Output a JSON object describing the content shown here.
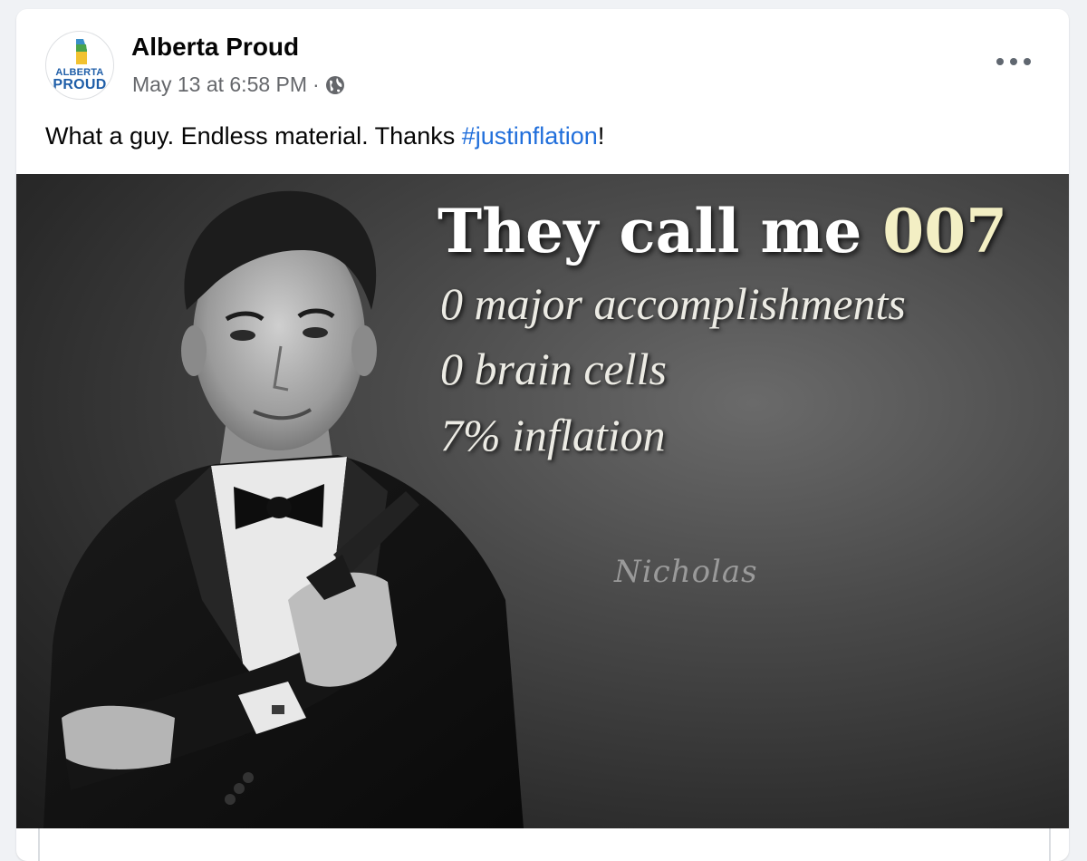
{
  "post": {
    "page_name": "Alberta Proud",
    "timestamp": "May 13 at 6:58 PM",
    "separator": "·",
    "privacy_icon": "globe-icon",
    "more_icon": "more-options-icon",
    "text_before_hashtag": "What a guy. Endless material. Thanks ",
    "hashtag": "#justinflation",
    "text_after_hashtag": "!"
  },
  "avatar": {
    "line1": "ALBERTA",
    "line2": "PROUD"
  },
  "meme": {
    "title_main": "They call me ",
    "title_accent": "007",
    "line1": "0 major accomplishments",
    "line2": "0 brain cells",
    "line3": "7% inflation",
    "signature": "Nicholas"
  },
  "colors": {
    "hashtag": "#216fdb",
    "page_name": "#050505",
    "meta": "#65676b",
    "title_accent": "#f3efc4",
    "logo_blue": "#1f5ea8"
  }
}
